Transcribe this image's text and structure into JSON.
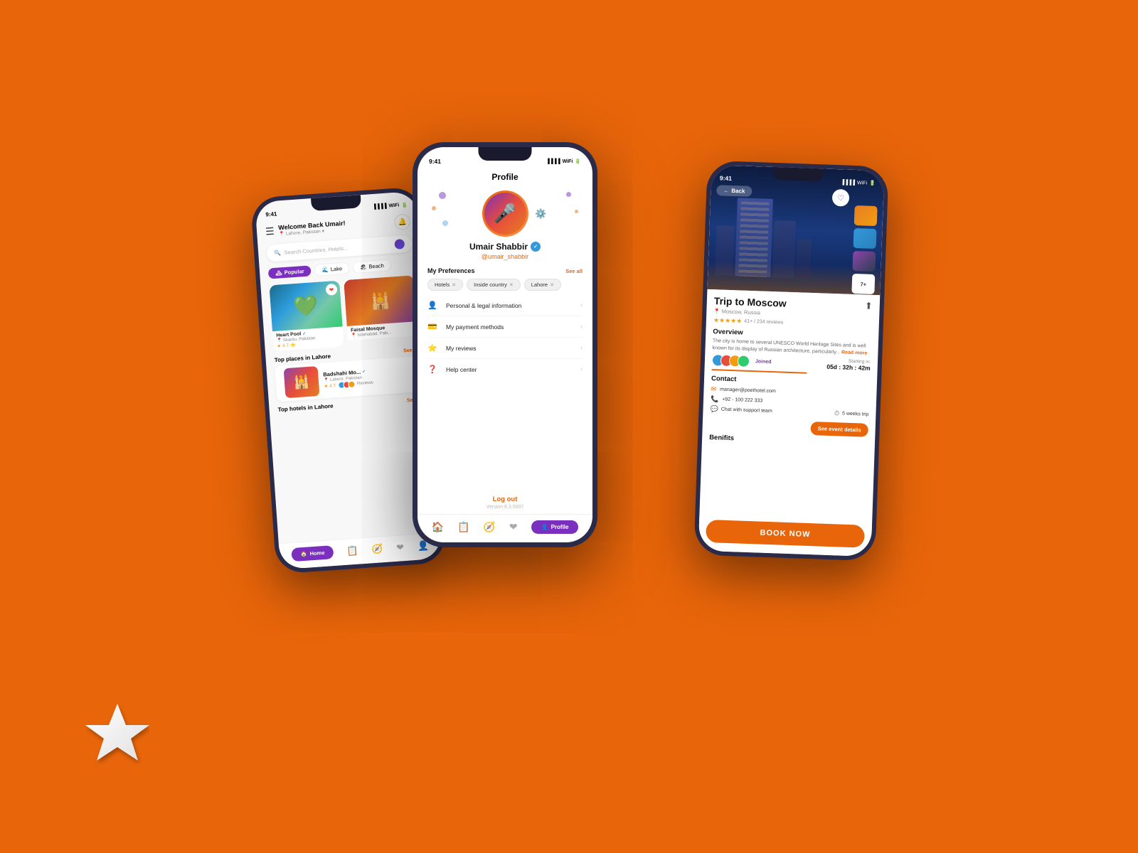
{
  "background_color": "#E8650A",
  "left_phone": {
    "time": "9:41",
    "header": {
      "welcome": "Welcome Back Umair!",
      "location": "Lahore, Pakistan",
      "search_placeholder": "Search Countries, Hotels..."
    },
    "categories": [
      {
        "label": "Popular",
        "active": true,
        "icon": "🏔"
      },
      {
        "label": "Lake",
        "active": false,
        "icon": "🌊"
      },
      {
        "label": "Beach",
        "active": false,
        "icon": "🏖"
      }
    ],
    "cards": [
      {
        "name": "Heart Pool",
        "location": "Skardu, Pakistan",
        "rating": "4.7",
        "type": "lake"
      },
      {
        "name": "Faisal Mosque",
        "location": "Islamabad, Paki...",
        "type": "mosque"
      }
    ],
    "sections": [
      {
        "title": "Top places in Lahore",
        "see_all": "See all",
        "items": [
          {
            "name": "Badshahi Mo...",
            "location": "Lahore, Pakistan",
            "rating": "4.7",
            "reviews": "Reviews",
            "verified": true
          }
        ]
      },
      {
        "title": "Top hotels in Lahore",
        "see_all": "See all"
      }
    ],
    "nav": [
      {
        "label": "Home",
        "active": true,
        "icon": "🏠"
      },
      {
        "label": "Bookings",
        "active": false,
        "icon": "📋"
      },
      {
        "label": "Explore",
        "active": false,
        "icon": "🧭"
      },
      {
        "label": "Favorites",
        "active": false,
        "icon": "❤"
      },
      {
        "label": "Profile",
        "active": false,
        "icon": "👤"
      }
    ]
  },
  "center_phone": {
    "time": "9:41",
    "title": "Profile",
    "user": {
      "name": "Umair Shabbir",
      "handle": "@umair_shabbir",
      "verified": true
    },
    "preferences": {
      "title": "My Preferences",
      "see_all": "See all",
      "tags": [
        "Hotels",
        "Inside country",
        "Lahore"
      ]
    },
    "menu_items": [
      {
        "label": "Personal & legal information",
        "icon": "👤"
      },
      {
        "label": "My payment methods",
        "icon": "💳"
      },
      {
        "label": "My reviews",
        "icon": "⭐"
      },
      {
        "label": "Help center",
        "icon": "❓"
      }
    ],
    "logout_label": "Log out",
    "version": "Version 8.3.5007",
    "nav": [
      {
        "label": "",
        "icon": "🏠"
      },
      {
        "label": "",
        "icon": "📋"
      },
      {
        "label": "",
        "icon": "🧭"
      },
      {
        "label": "",
        "icon": "❤"
      },
      {
        "label": "Profile",
        "active": true,
        "icon": "👤"
      }
    ]
  },
  "right_phone": {
    "time": "9:41",
    "hero": {
      "back_label": "Back",
      "title": "Trip to Moscow",
      "location": "Moscow, Russia",
      "rating": "4.8",
      "reviews_count": "41+ / 234 reviews",
      "thumbnails_extra": "7+"
    },
    "overview": {
      "title": "Overview",
      "text": "The city is home to several UNESCO World Heritage Sites and is well known for its display of Russian architecture, particularly...",
      "read_more": "Read more"
    },
    "starting": {
      "label": "Starting in:",
      "countdown": "05d : 32h : 42m",
      "joined_label": "Joined"
    },
    "contact": {
      "title": "Contact",
      "email": "manager@poethotel.com",
      "phone": "+92 - 100 222 333",
      "support": "Chat with support team",
      "trip_duration": "5 weeks trip",
      "see_event_label": "See event details"
    },
    "benefits": {
      "title": "Benifits"
    },
    "book_now": "BOOK NOW"
  }
}
